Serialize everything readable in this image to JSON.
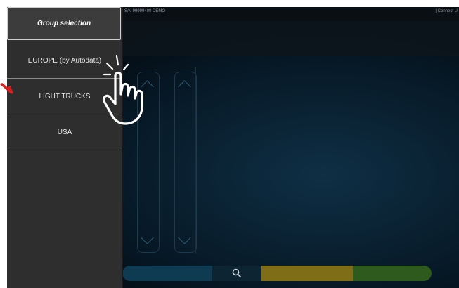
{
  "header": {
    "serial": "S/N 99999480 DEMO",
    "connect": "|  Connect U"
  },
  "menu": {
    "title": "Group selection",
    "items": [
      "EUROPE (by Autodata)",
      "LIGHT TRUCKS",
      "USA"
    ]
  },
  "icons": {
    "search": "search-icon",
    "pointer": "tap-hand-icon",
    "arrow": "red-arrow-icon"
  },
  "colors": {
    "panel_bg": "#2e2e2e",
    "accent_yellow": "#7f6e17",
    "accent_green": "#2f5a1d",
    "accent_blue": "#0f3b52",
    "arrow": "#d92020"
  }
}
